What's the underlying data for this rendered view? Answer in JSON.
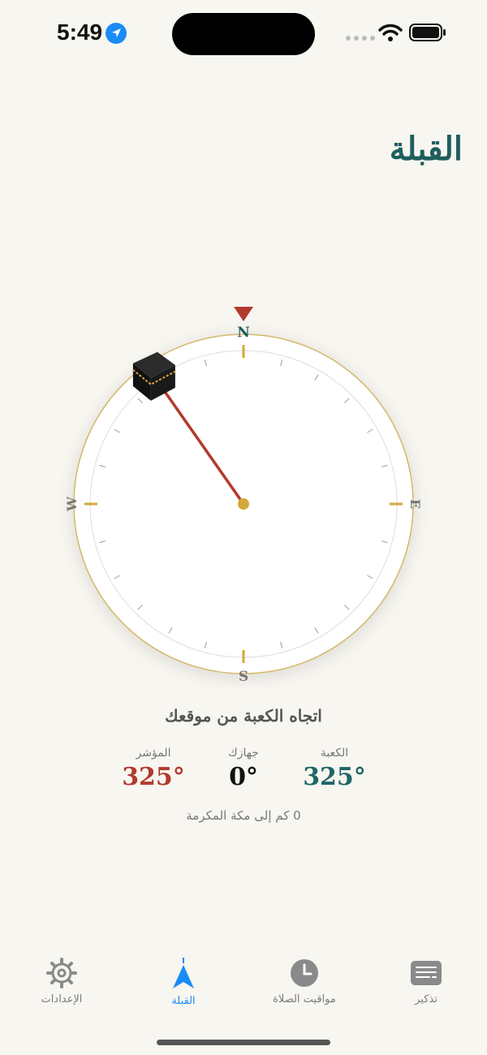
{
  "status": {
    "time": "5:49"
  },
  "header": {
    "title": "القبلة"
  },
  "compass": {
    "north": "N",
    "south": "S",
    "east": "E",
    "west": "W",
    "needle_bearing_deg": 325
  },
  "direction": {
    "label": "اتجاه الكعبة من موقعك",
    "kaaba_label": "الكعبة",
    "kaaba_value": "325°",
    "device_label": "جهازك",
    "device_value": "0°",
    "pointer_label": "المؤشر",
    "pointer_value": "325°",
    "distance": "0 كم إلى مكة المكرمة"
  },
  "tabs": {
    "settings": "الإعدادات",
    "qibla": "القبلة",
    "prayer_times": "مواقيت الصلاة",
    "remind": "تذكير"
  },
  "colors": {
    "accent": "#1a8cf5",
    "teal": "#1e5e5e",
    "red": "#b23a2c",
    "gold": "#d4a73b"
  }
}
